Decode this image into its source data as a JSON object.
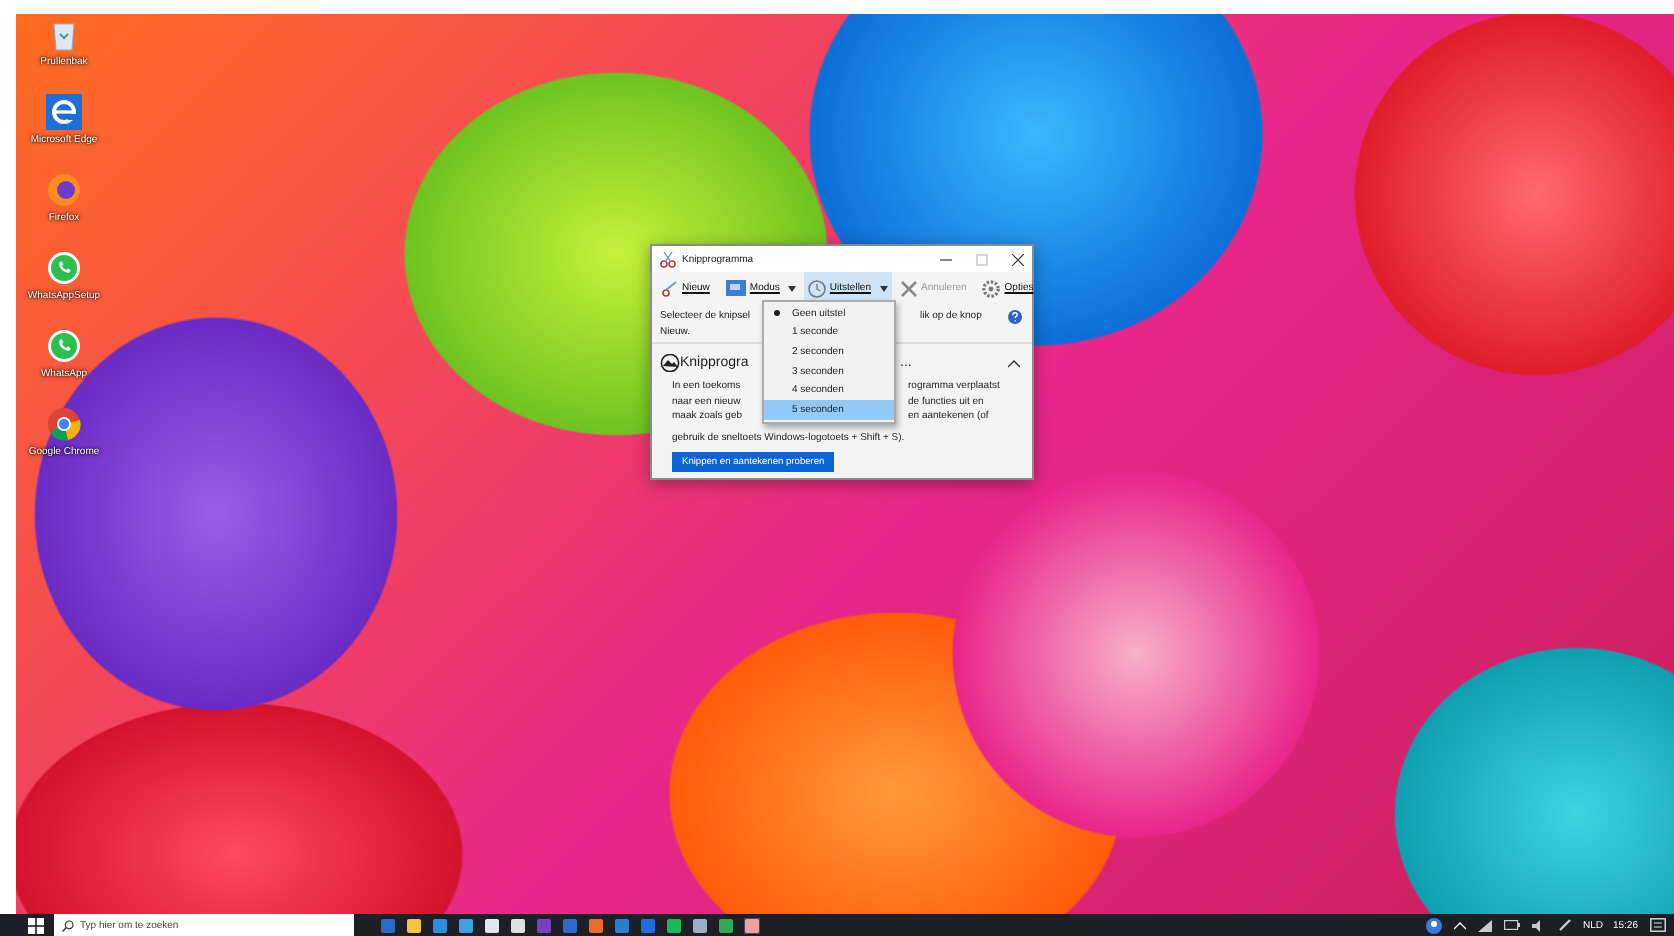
{
  "desktop_icons": [
    {
      "label": "Prullenbak",
      "kind": "bin"
    },
    {
      "label": "Microsoft Edge",
      "kind": "edge"
    },
    {
      "label": "Firefox",
      "kind": "firefox"
    },
    {
      "label": "WhatsAppSetup",
      "kind": "whatsapp"
    },
    {
      "label": "WhatsApp",
      "kind": "whatsapp"
    },
    {
      "label": "Google Chrome",
      "kind": "chrome"
    }
  ],
  "window": {
    "title": "Knipprogramma",
    "toolbar": [
      {
        "label": "Nieuw",
        "kind": "new",
        "pressed": false,
        "disabled": false,
        "dropdown": false
      },
      {
        "label": "Modus",
        "kind": "mode",
        "pressed": false,
        "disabled": false,
        "dropdown": true
      },
      {
        "label": "Uitstellen",
        "kind": "delay",
        "pressed": true,
        "disabled": false,
        "dropdown": true
      },
      {
        "label": "Annuleren",
        "kind": "cancel",
        "pressed": false,
        "disabled": true,
        "dropdown": false
      },
      {
        "label": "Opties",
        "kind": "options",
        "pressed": false,
        "disabled": false,
        "dropdown": false
      }
    ],
    "instruction": {
      "left": "Selecteer de knipsel",
      "right": "lik op de knop",
      "second_line": "Nieuw."
    },
    "notice": {
      "title_left": "Knipprogra",
      "title_right": "...",
      "expanded": true,
      "lines": [
        [
          "In een toekoms",
          "rogramma verplaatst"
        ],
        [
          "naar een nieuw",
          "de functies uit en"
        ],
        [
          "maak zoals geb",
          "en aantekenen (of"
        ]
      ],
      "last_line": "gebruik de sneltoets Windows-logotoets + Shift + S).",
      "button": "Knippen en aantekenen proberen"
    },
    "delay_menu": [
      {
        "label": "Geen uitstel",
        "selected": true,
        "highlighted": false
      },
      {
        "label": "1 seconde",
        "selected": false,
        "highlighted": false
      },
      {
        "label": "2 seconden",
        "selected": false,
        "highlighted": false
      },
      {
        "label": "3 seconden",
        "selected": false,
        "highlighted": false
      },
      {
        "label": "4 seconden",
        "selected": false,
        "highlighted": false
      },
      {
        "label": "5 seconden",
        "selected": false,
        "highlighted": true
      }
    ]
  },
  "taskbar": {
    "search_placeholder": "Typ hier om te zoeken",
    "language": "NLD",
    "time": "15:26"
  }
}
